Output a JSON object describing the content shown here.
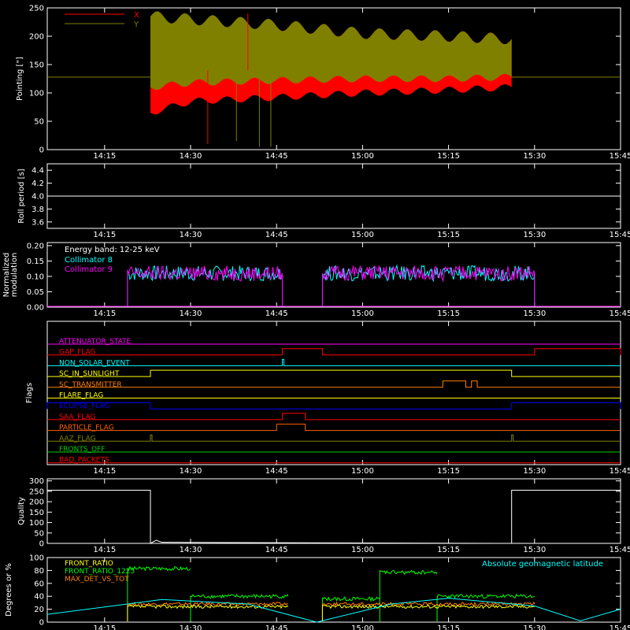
{
  "colors": {
    "background": "#000000",
    "axes": "#ffffff",
    "x_red": "#ff0000",
    "y_olive": "#808000",
    "cyan": "#00ffff",
    "magenta": "#ff00ff",
    "white": "#ffffff"
  },
  "time_axis": {
    "start": "14:05",
    "end": "15:45",
    "ticks": [
      "14:15",
      "14:30",
      "14:45",
      "15:00",
      "15:15",
      "15:30",
      "15:45"
    ]
  },
  "chart_data": [
    {
      "id": "pointing",
      "type": "area",
      "ylabel": "Pointing [\"]",
      "ylim": [
        0,
        250
      ],
      "yticks": [
        "0",
        "50",
        "100",
        "150",
        "200",
        "250"
      ],
      "legend": [
        {
          "label": "X",
          "color": "#ff0000"
        },
        {
          "label": "Y",
          "color": "#808000"
        }
      ],
      "reference_line": 128,
      "series": [
        {
          "name": "X",
          "start": "14:23",
          "end": "15:26",
          "x": [
            "14:23",
            "14:30",
            "14:45",
            "15:00",
            "15:15",
            "15:26"
          ],
          "low": [
            65,
            85,
            92,
            100,
            105,
            110
          ],
          "high": [
            230,
            225,
            220,
            205,
            200,
            195
          ]
        },
        {
          "name": "Y",
          "start": "14:23",
          "end": "15:26",
          "x": [
            "14:23",
            "14:30",
            "14:45",
            "15:00",
            "15:15",
            "15:26"
          ],
          "low": [
            110,
            118,
            122,
            125,
            125,
            128
          ],
          "high": [
            235,
            230,
            220,
            205,
            200,
            195
          ]
        }
      ]
    },
    {
      "id": "roll-period",
      "type": "line",
      "ylabel": "Roll period [s]",
      "ylim": [
        3.5,
        4.5
      ],
      "yticks": [
        "3.6",
        "3.8",
        "4.0",
        "4.2",
        "4.4"
      ],
      "series": [
        {
          "name": "",
          "start": "14:05",
          "end": "15:45",
          "value": 4.0
        }
      ]
    },
    {
      "id": "modulation",
      "type": "line",
      "ylabel": "Normalized modulation",
      "ylim": [
        0,
        0.21
      ],
      "yticks": [
        "0.00",
        "0.05",
        "0.10",
        "0.15",
        "0.20"
      ],
      "annotation": "Energy band: 12-25 keV",
      "legend": [
        {
          "label": "Collimator 8",
          "color": "#00ffff"
        },
        {
          "label": "Collimator 9",
          "color": "#ff00ff"
        }
      ],
      "segments": [
        {
          "start": "14:19",
          "end": "14:46",
          "mean": 0.11
        },
        {
          "start": "14:53",
          "end": "15:30",
          "mean": 0.11
        }
      ]
    },
    {
      "id": "flags",
      "type": "line",
      "ylabel": "Flags",
      "flags": [
        {
          "label": "ATTENUATOR_STATE",
          "color": "#ff00ff",
          "high": []
        },
        {
          "label": "GAP_FLAG",
          "color": "#ff0000",
          "high": [
            [
              "14:46",
              "14:53"
            ],
            [
              "15:30",
              "15:45"
            ]
          ]
        },
        {
          "label": "NON_SOLAR_EVENT",
          "color": "#00ffff",
          "high": [
            [
              "14:46",
              "14:46"
            ]
          ]
        },
        {
          "label": "SC_IN_SUNLIGHT",
          "color": "#ffff00",
          "high": [
            [
              "14:23",
              "15:26"
            ]
          ]
        },
        {
          "label": "SC_TRANSMITTER",
          "color": "#ff8000",
          "high": [
            [
              "15:14",
              "15:18"
            ],
            [
              "15:19",
              "15:20"
            ]
          ]
        },
        {
          "label": "FLARE_FLAG",
          "color": "#ffff00",
          "high": []
        },
        {
          "label": "ECLIPSE_FLAG",
          "color": "#0000ff",
          "high": [
            [
              "14:05",
              "14:23"
            ],
            [
              "15:26",
              "15:45"
            ]
          ]
        },
        {
          "label": "SAA_FLAG",
          "color": "#ff0000",
          "high": [
            [
              "14:46",
              "14:50"
            ]
          ]
        },
        {
          "label": "PARTICLE_FLAG",
          "color": "#ff6000",
          "high": [
            [
              "14:45",
              "14:50"
            ]
          ]
        },
        {
          "label": "AAZ_FLAG",
          "color": "#808000",
          "high": [
            [
              "14:23",
              "14:23"
            ],
            [
              "15:26",
              "15:26"
            ]
          ]
        },
        {
          "label": "FRONTS_OFF",
          "color": "#00cc00",
          "high": []
        },
        {
          "label": "BAD_PACKETS",
          "color": "#ff0000",
          "high": []
        }
      ]
    },
    {
      "id": "quality",
      "type": "line",
      "ylabel": "Quality",
      "ylim": [
        0,
        310
      ],
      "yticks": [
        "0",
        "50",
        "100",
        "150",
        "200",
        "250",
        "300"
      ],
      "points": [
        {
          "x": "14:05",
          "y": 255
        },
        {
          "x": "14:23",
          "y": 255
        },
        {
          "x": "14:23",
          "y": 0
        },
        {
          "x": "14:24",
          "y": 15
        },
        {
          "x": "14:25",
          "y": 5
        },
        {
          "x": "15:26",
          "y": 0
        },
        {
          "x": "15:26",
          "y": 255
        },
        {
          "x": "15:45",
          "y": 255
        }
      ]
    },
    {
      "id": "ratios",
      "type": "line",
      "ylabel": "Degrees or %",
      "ylim": [
        0,
        100
      ],
      "yticks": [
        "0",
        "20",
        "40",
        "60",
        "80",
        "100"
      ],
      "annotation": "Absolute geomagnetic latitude",
      "legend": [
        {
          "label": "FRONT_RATIO",
          "color": "#ffff00"
        },
        {
          "label": "FRONT_RATIO_1225",
          "color": "#00ff00"
        },
        {
          "label": "MAX_DET_VS_TOT",
          "color": "#ff8000"
        }
      ],
      "series": [
        {
          "name": "FRONT_RATIO_1225",
          "color": "#00ff00",
          "segments": [
            {
              "start": "14:19",
              "end": "14:30",
              "value": 83
            },
            {
              "start": "14:30",
              "end": "14:47",
              "value": 40
            },
            {
              "start": "14:53",
              "end": "15:03",
              "value": 36
            },
            {
              "start": "15:03",
              "end": "15:13",
              "value": 77
            },
            {
              "start": "15:13",
              "end": "15:30",
              "value": 40
            }
          ]
        },
        {
          "name": "MAX_DET_VS_TOT",
          "color": "#ff8000",
          "segments": [
            {
              "start": "14:19",
              "end": "14:47",
              "value": 28
            },
            {
              "start": "14:53",
              "end": "15:30",
              "value": 28
            }
          ]
        },
        {
          "name": "FRONT_RATIO",
          "color": "#ffff00",
          "segments": [
            {
              "start": "14:19",
              "end": "14:47",
              "value": 24
            },
            {
              "start": "14:53",
              "end": "15:30",
              "value": 24
            }
          ]
        },
        {
          "name": "Absolute geomagnetic latitude",
          "color": "#00ffff",
          "points": [
            {
              "x": "14:05",
              "y": 12
            },
            {
              "x": "14:25",
              "y": 35
            },
            {
              "x": "14:40",
              "y": 28
            },
            {
              "x": "14:52",
              "y": 0
            },
            {
              "x": "15:05",
              "y": 28
            },
            {
              "x": "15:15",
              "y": 37
            },
            {
              "x": "15:30",
              "y": 25
            },
            {
              "x": "15:38",
              "y": 2
            },
            {
              "x": "15:45",
              "y": 20
            }
          ]
        }
      ]
    }
  ]
}
